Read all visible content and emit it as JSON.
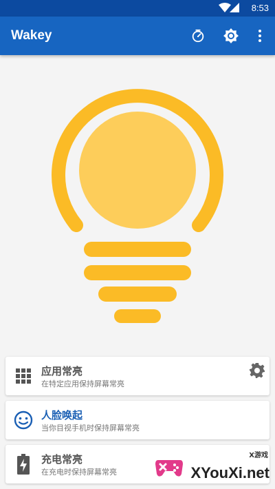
{
  "status_bar": {
    "time": "8:53"
  },
  "app_bar": {
    "title": "Wakey"
  },
  "cards": [
    {
      "title": "应用常亮",
      "subtitle": "在特定应用保持屏幕常亮",
      "icon": "app-grid-icon"
    },
    {
      "title": "人脸唤起",
      "subtitle": "当你目视手机时保持屏幕常亮",
      "icon": "face-icon"
    },
    {
      "title": "充电常亮",
      "subtitle": "在充电时保持屏幕常亮",
      "icon": "battery-charging-icon"
    }
  ],
  "watermark": {
    "brand": "XYouXi.net",
    "brand_sub": "X游戏"
  },
  "colors": {
    "status_bar": "#0c4aa0",
    "app_bar": "#1765c1",
    "bulb_ring": "#fbbb26",
    "bulb_fill": "#fdcd5a",
    "accent": "#1a5fb4"
  }
}
